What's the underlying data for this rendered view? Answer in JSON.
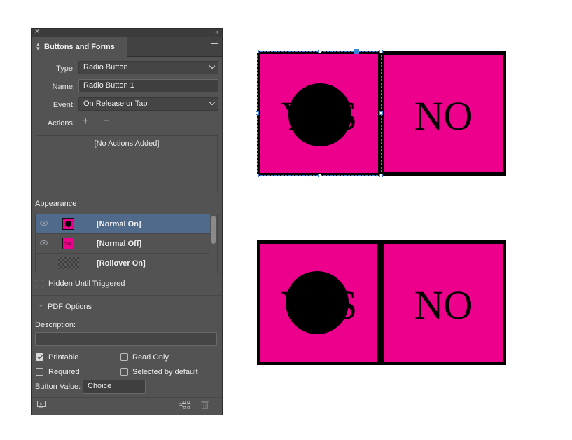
{
  "panel": {
    "tab_title": "Buttons and Forms",
    "type_label": "Type:",
    "type_value": "Radio Button",
    "name_label": "Name:",
    "name_value": "Radio Button 1",
    "event_label": "Event:",
    "event_value": "On Release or Tap",
    "actions_label": "Actions:",
    "add_symbol": "+",
    "remove_symbol": "−",
    "no_actions": "[No Actions Added]",
    "appearance_label": "Appearance",
    "appearances": [
      {
        "label": "[Normal On]",
        "selected": true,
        "visible": true
      },
      {
        "label": "[Normal Off]",
        "selected": false,
        "visible": true
      },
      {
        "label": "[Rollover On]",
        "selected": false,
        "visible": false
      }
    ],
    "hidden_until_triggered": "Hidden Until Triggered",
    "pdf_options": "PDF Options",
    "description_label": "Description:",
    "description_value": "",
    "printable": "Printable",
    "read_only": "Read Only",
    "required": "Required",
    "selected_by_default": "Selected by default",
    "button_value_label": "Button Value:",
    "button_value": "Choice",
    "thumb_text": "YES"
  },
  "canvas": {
    "yes_label": "YES",
    "no_label": "NO",
    "accent_color": "#ec008c",
    "selection_color": "#3c86d6"
  }
}
